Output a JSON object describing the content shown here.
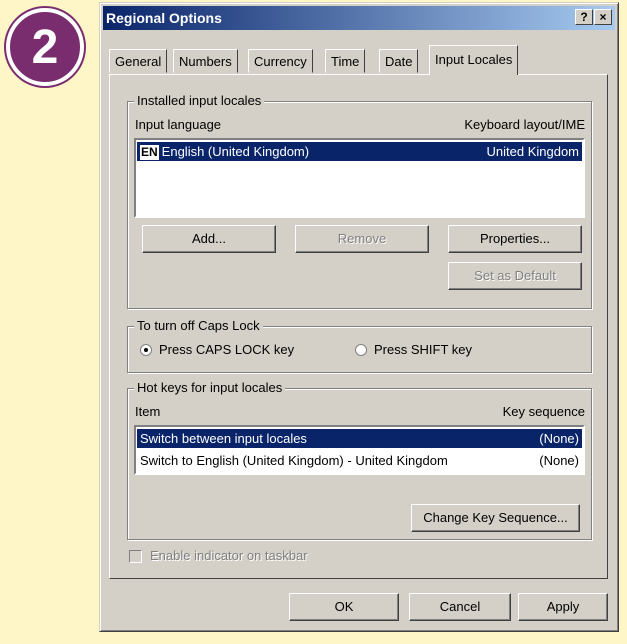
{
  "step_number": "2",
  "window": {
    "title": "Regional Options",
    "help_label": "?",
    "close_label": "×"
  },
  "tabs": [
    "General",
    "Numbers",
    "Currency",
    "Time",
    "Date",
    "Input Locales"
  ],
  "installed": {
    "group_label": "Installed input locales",
    "col_language": "Input language",
    "col_layout": "Keyboard layout/IME",
    "rows": [
      {
        "badge": "EN",
        "language": "English (United Kingdom)",
        "layout": "United Kingdom",
        "selected": true
      }
    ],
    "add_label": "Add...",
    "remove_label": "Remove",
    "properties_label": "Properties...",
    "set_default_label": "Set as Default"
  },
  "caps": {
    "group_label": "To turn off Caps Lock",
    "option1": "Press CAPS LOCK key",
    "option2": "Press SHIFT key",
    "selected": 1
  },
  "hotkeys": {
    "group_label": "Hot keys for input locales",
    "col_item": "Item",
    "col_sequence": "Key sequence",
    "rows": [
      {
        "item": "Switch between input locales",
        "sequence": "(None)",
        "selected": true
      },
      {
        "item": "Switch to English (United Kingdom) - United Kingdom",
        "sequence": "(None)",
        "selected": false
      }
    ],
    "change_label": "Change Key Sequence..."
  },
  "indicator_label": "Enable indicator on taskbar",
  "footer": {
    "ok_label": "OK",
    "cancel_label": "Cancel",
    "apply_label": "Apply"
  }
}
